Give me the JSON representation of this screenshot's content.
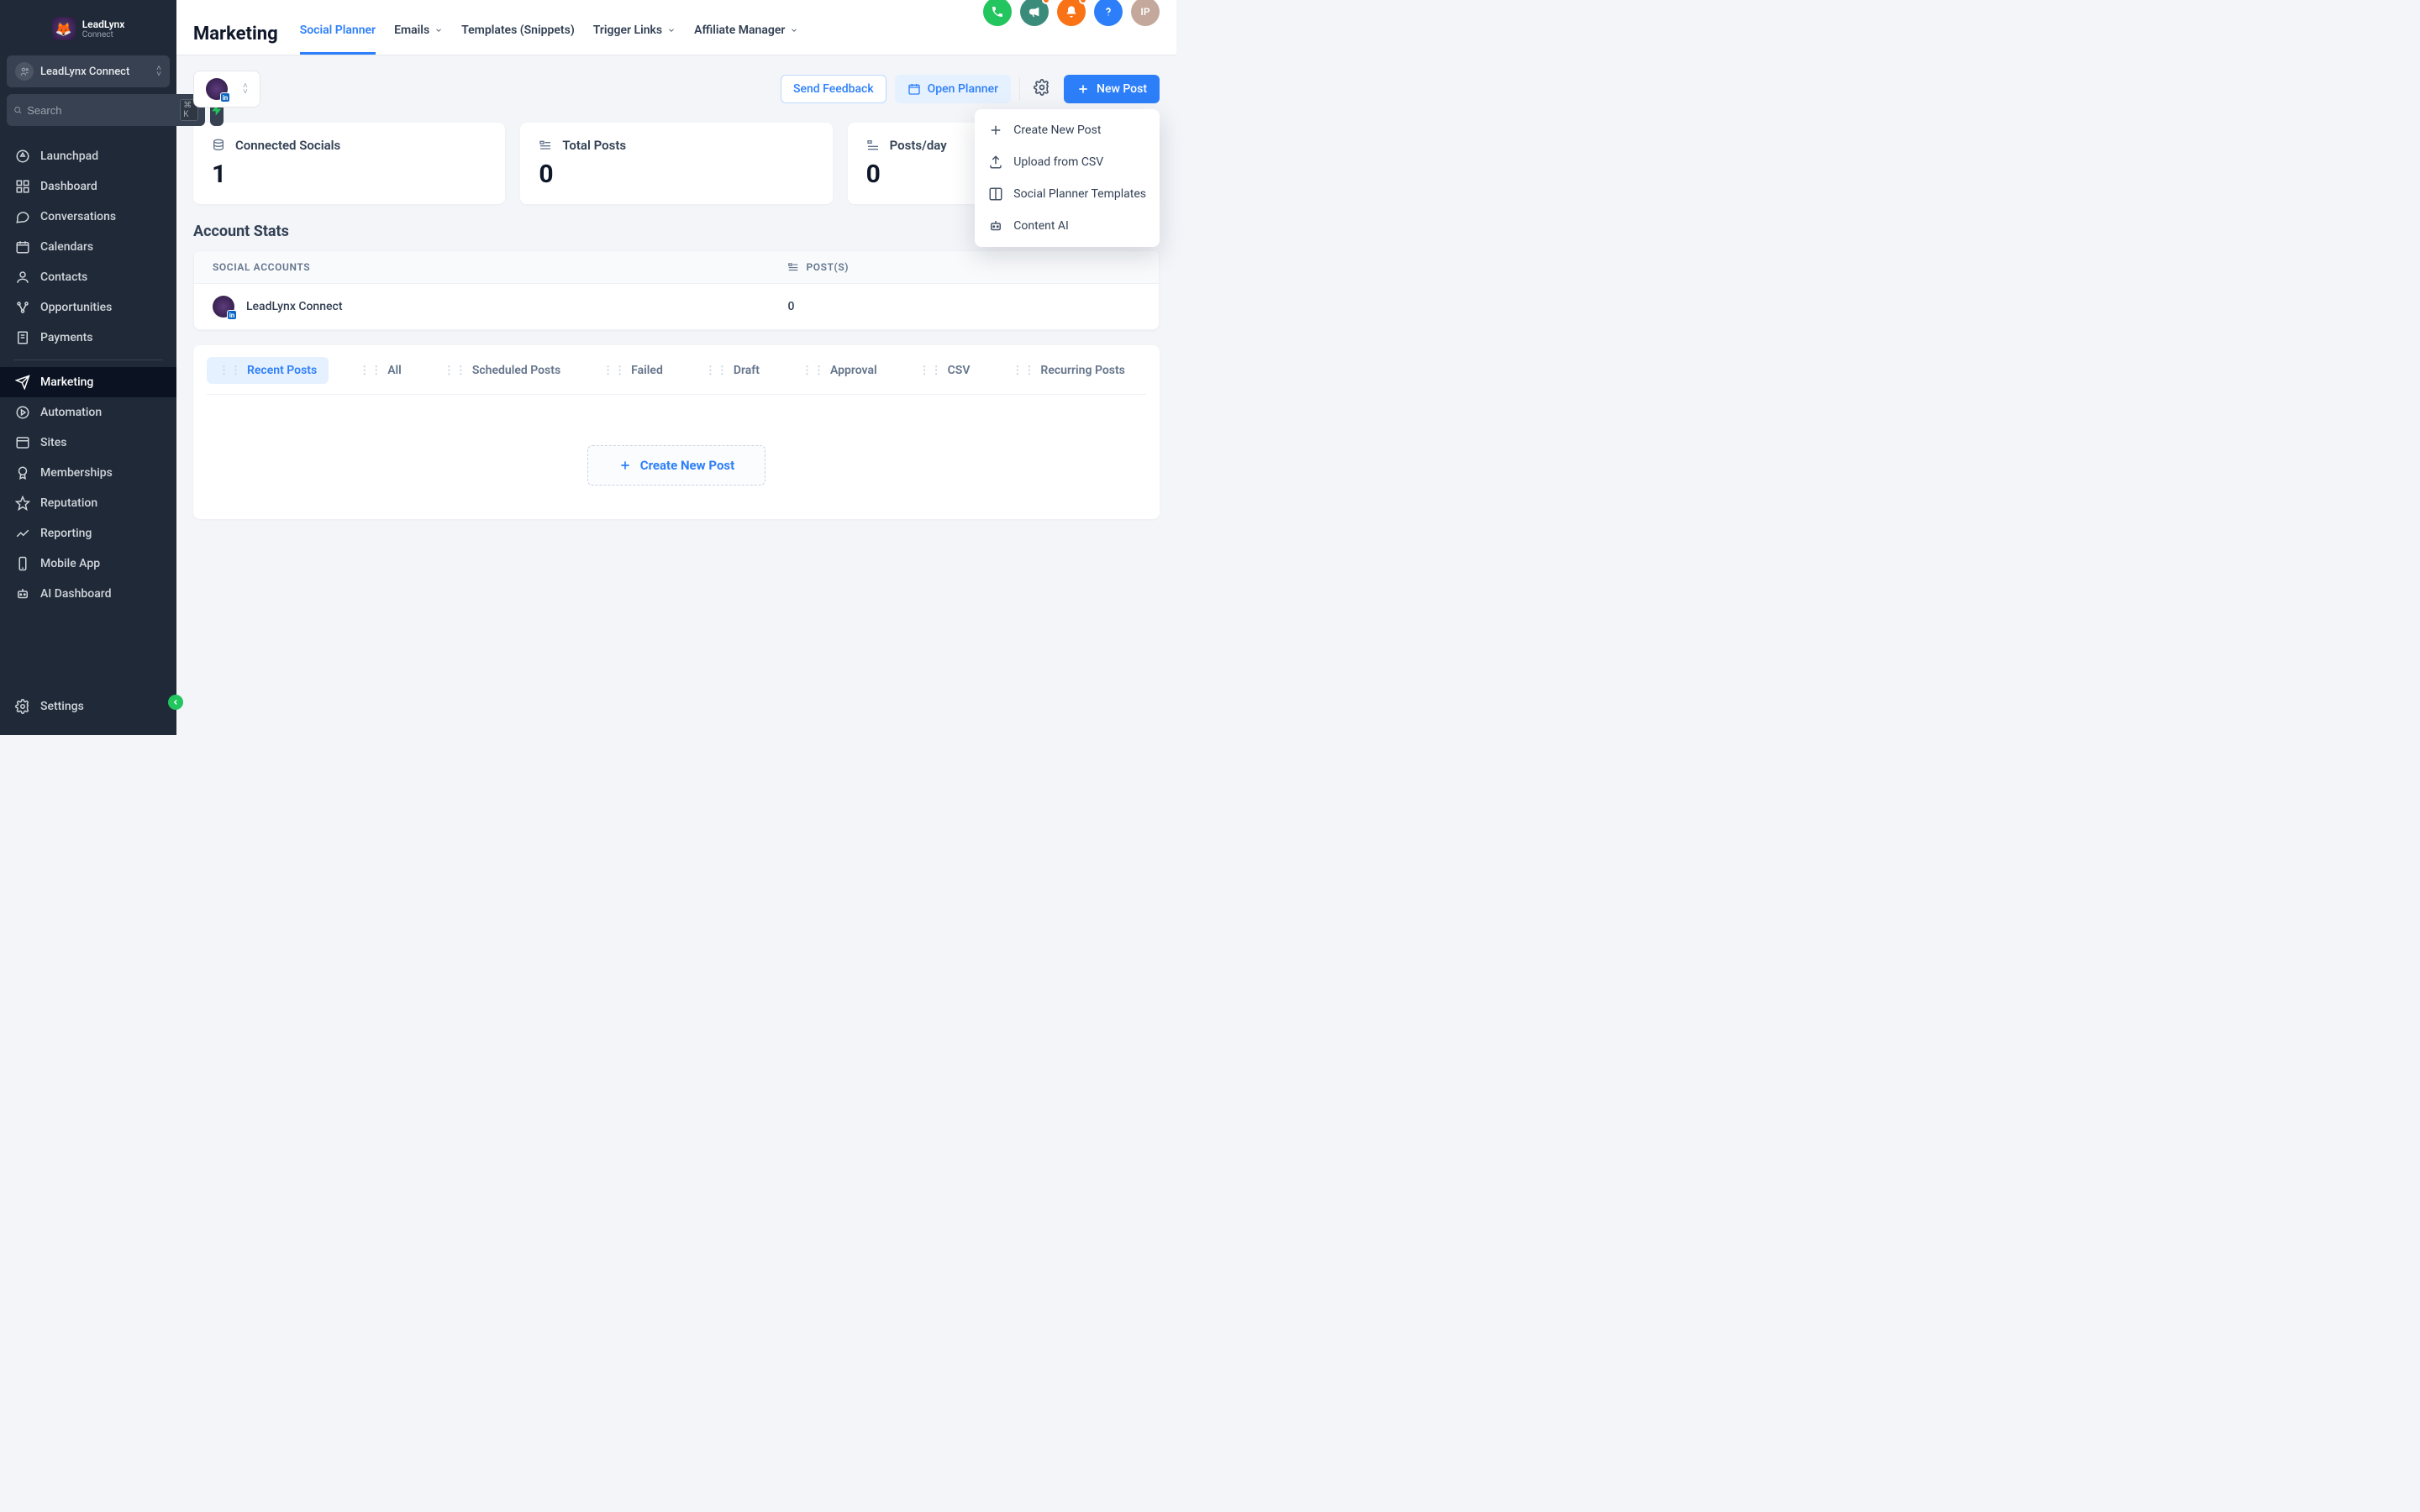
{
  "brand": {
    "title": "LeadLynx",
    "subtitle": "Connect"
  },
  "account": {
    "name": "LeadLynx Connect"
  },
  "search": {
    "placeholder": "Search",
    "shortcut": "⌘ K"
  },
  "sidebar": {
    "items": [
      {
        "label": "Launchpad"
      },
      {
        "label": "Dashboard"
      },
      {
        "label": "Conversations"
      },
      {
        "label": "Calendars"
      },
      {
        "label": "Contacts"
      },
      {
        "label": "Opportunities"
      },
      {
        "label": "Payments"
      }
    ],
    "items2": [
      {
        "label": "Marketing",
        "active": true
      },
      {
        "label": "Automation"
      },
      {
        "label": "Sites"
      },
      {
        "label": "Memberships"
      },
      {
        "label": "Reputation"
      },
      {
        "label": "Reporting"
      },
      {
        "label": "Mobile App"
      },
      {
        "label": "AI Dashboard"
      }
    ],
    "settings_label": "Settings"
  },
  "header": {
    "title": "Marketing",
    "tabs": [
      {
        "label": "Social Planner",
        "active": true
      },
      {
        "label": "Emails",
        "dropdown": true
      },
      {
        "label": "Templates (Snippets)"
      },
      {
        "label": "Trigger Links",
        "dropdown": true
      },
      {
        "label": "Affiliate Manager",
        "dropdown": true
      }
    ],
    "avatar_initials": "IP"
  },
  "toolbar": {
    "send_feedback": "Send Feedback",
    "open_planner": "Open Planner",
    "new_post": "New Post"
  },
  "dropdown": {
    "items": [
      {
        "label": "Create New Post"
      },
      {
        "label": "Upload from CSV"
      },
      {
        "label": "Social Planner Templates"
      },
      {
        "label": "Content AI"
      }
    ]
  },
  "stats": [
    {
      "label": "Connected Socials",
      "value": "1"
    },
    {
      "label": "Total Posts",
      "value": "0"
    },
    {
      "label": "Posts/day",
      "value": "0"
    }
  ],
  "section_title": "Account Stats",
  "table": {
    "col_social": "SOCIAL ACCOUNTS",
    "col_posts": "POST(S)",
    "rows": [
      {
        "name": "LeadLynx Connect",
        "posts": "0"
      }
    ]
  },
  "post_tabs": [
    {
      "label": "Recent Posts",
      "active": true
    },
    {
      "label": "All"
    },
    {
      "label": "Scheduled Posts"
    },
    {
      "label": "Failed"
    },
    {
      "label": "Draft"
    },
    {
      "label": "Approval"
    },
    {
      "label": "CSV"
    },
    {
      "label": "Recurring Posts"
    }
  ],
  "empty_state": {
    "create_label": "Create New Post"
  }
}
